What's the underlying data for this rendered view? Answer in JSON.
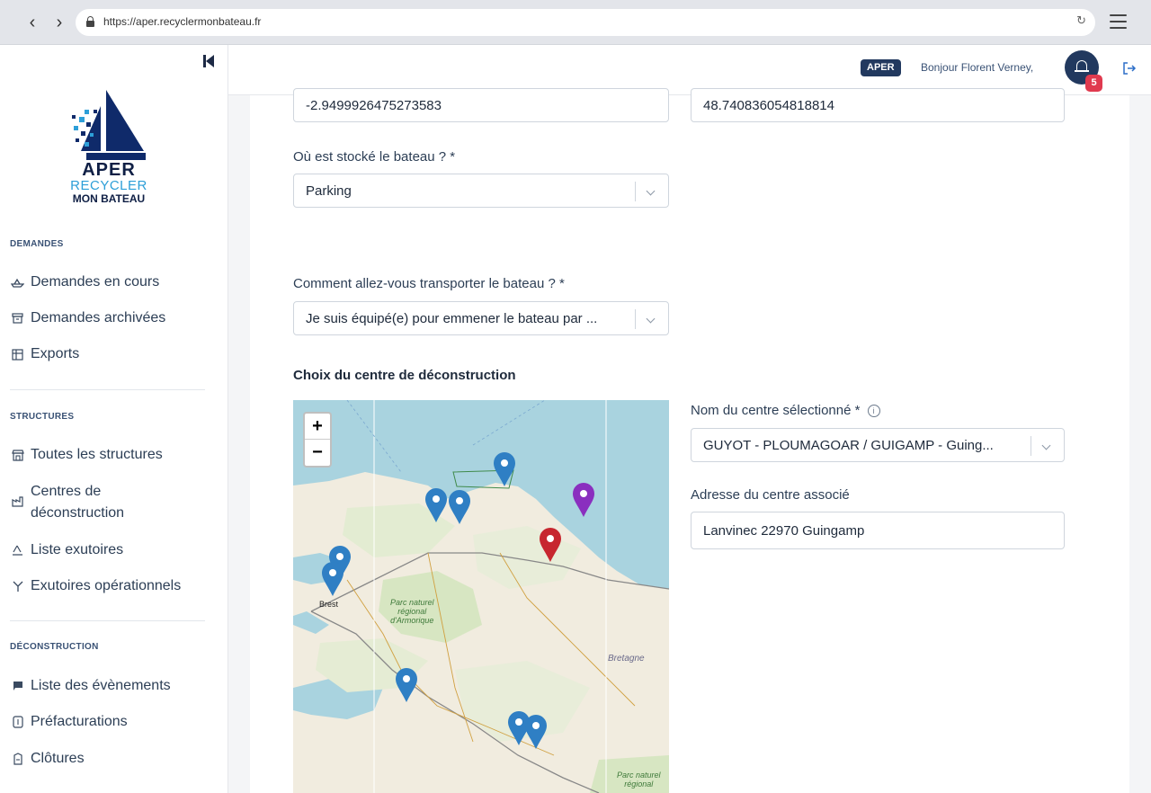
{
  "browser": {
    "url": "https://aper.recyclermonbateau.fr",
    "back_label": "‹",
    "forward_label": "›",
    "reload_label": "↻"
  },
  "sidebar": {
    "logo": {
      "line1": "APER",
      "line2": "RECYCLER",
      "line3": "MON BATEAU"
    },
    "sections": [
      {
        "title": "DEMANDES"
      },
      {
        "title": "STRUCTURES"
      },
      {
        "title": "DÉCONSTRUCTION"
      }
    ],
    "items": [
      {
        "label": "Demandes en cours",
        "icon": "boat-icon"
      },
      {
        "label": "Demandes archivées",
        "icon": "archive-icon"
      },
      {
        "label": "Exports",
        "icon": "table-export-icon"
      },
      {
        "label": "Toutes les structures",
        "icon": "store-icon"
      },
      {
        "label_line1": "Centres de",
        "label_line2": "déconstruction",
        "icon": "factory-icon"
      },
      {
        "label": "Liste exutoires",
        "icon": "recycle-icon"
      },
      {
        "label": "Exutoires opérationnels",
        "icon": "split-icon"
      },
      {
        "label": "Liste des évènements",
        "icon": "flag-icon"
      },
      {
        "label": "Préfacturations",
        "icon": "invoice-icon"
      },
      {
        "label": "Clôtures",
        "icon": "closure-icon"
      }
    ]
  },
  "header": {
    "badge": "APER",
    "greeting": "Bonjour Florent Verney,",
    "notification_count": "5"
  },
  "form": {
    "longitude_value": "-2.9499926475273583",
    "latitude_value": "48.740836054818814",
    "storage_label": "Où est stocké le bateau ? *",
    "storage_value": "Parking",
    "transport_label": "Comment allez-vous transporter le bateau ? *",
    "transport_value": "Je suis équipé(e) pour emmener le bateau par ...",
    "center_section_title": "Choix du centre de déconstruction",
    "center_name_label": "Nom du centre sélectionné *",
    "center_name_value": "GUYOT - PLOUMAGOAR / GUIGAMP - Guing...",
    "center_address_label": "Adresse du centre associé",
    "center_address_value": "Lanvinec  22970 Guingamp"
  },
  "map": {
    "zoom_in": "+",
    "zoom_out": "−",
    "labels": {
      "park1_l1": "Parc naturel",
      "park1_l2": "régional",
      "park1_l3": "d'Armorique",
      "region": "Bretagne",
      "city": "Brest",
      "park2_l1": "Parc naturel",
      "park2_l2": "régional"
    },
    "marker_colors": {
      "default": "#2f7fc4",
      "selected": "#c7262f",
      "current": "#8a2fbf"
    }
  }
}
